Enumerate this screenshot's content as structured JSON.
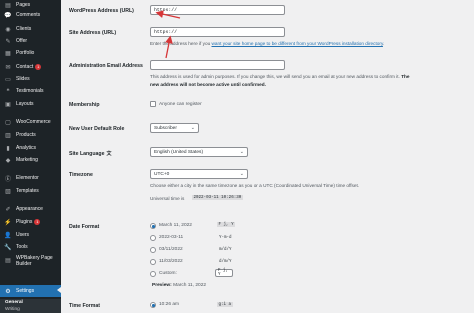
{
  "sidebar": {
    "items": [
      {
        "label": "Pages",
        "icon": "pages-icon",
        "glyph": "▤"
      },
      {
        "label": "Comments",
        "icon": "comments-icon",
        "glyph": "💬"
      },
      {
        "label": "Clients",
        "icon": "clients-icon",
        "glyph": "◉"
      },
      {
        "label": "Offer",
        "icon": "offer-icon",
        "glyph": "✎"
      },
      {
        "label": "Portfolio",
        "icon": "portfolio-icon",
        "glyph": "▦"
      },
      {
        "label": "Contact",
        "icon": "contact-icon",
        "glyph": "✉",
        "badge": "1"
      },
      {
        "label": "Slides",
        "icon": "slides-icon",
        "glyph": "▭"
      },
      {
        "label": "Testimonials",
        "icon": "testimonials-icon",
        "glyph": "❝"
      },
      {
        "label": "Layouts",
        "icon": "layouts-icon",
        "glyph": "▣"
      },
      {
        "label": "WooCommerce",
        "icon": "woocommerce-icon",
        "glyph": "▢"
      },
      {
        "label": "Products",
        "icon": "products-icon",
        "glyph": "▥"
      },
      {
        "label": "Analytics",
        "icon": "analytics-icon",
        "glyph": "▮"
      },
      {
        "label": "Marketing",
        "icon": "marketing-icon",
        "glyph": "◆"
      },
      {
        "label": "Elementor",
        "icon": "elementor-icon",
        "glyph": "Ⓔ"
      },
      {
        "label": "Templates",
        "icon": "templates-icon",
        "glyph": "▧"
      },
      {
        "label": "Appearance",
        "icon": "appearance-icon",
        "glyph": "✐"
      },
      {
        "label": "Plugins",
        "icon": "plugins-icon",
        "glyph": "⚡",
        "badge": "1"
      },
      {
        "label": "Users",
        "icon": "users-icon",
        "glyph": "👤"
      },
      {
        "label": "Tools",
        "icon": "tools-icon",
        "glyph": "🔧"
      },
      {
        "label": "WPBakery Page Builder",
        "icon": "wpbakery-icon",
        "glyph": "▤"
      },
      {
        "label": "Settings",
        "icon": "settings-icon",
        "glyph": "⚙"
      }
    ],
    "submenu": [
      "General",
      "Writing"
    ]
  },
  "form": {
    "wordpress_address": {
      "label": "WordPress Address (URL)",
      "value": "https://"
    },
    "site_address": {
      "label": "Site Address (URL)",
      "value": "https://",
      "desc_before": "Enter the address here if you ",
      "desc_link": "want your site home page to be different from your WordPress installation directory",
      "desc_after": "."
    },
    "admin_email": {
      "label": "Administration Email Address",
      "desc_line1": "This address is used for admin purposes. If you change this, we will send you an email at your new address to confirm it.",
      "desc_line2": "The",
      "desc_line3": "new address will not become active until confirmed."
    },
    "membership": {
      "label": "Membership",
      "checkbox_label": "Anyone can register"
    },
    "default_role": {
      "label": "New User Default Role",
      "value": "Subscriber"
    },
    "site_language": {
      "label": "Site Language",
      "value": "English (United States)"
    },
    "timezone": {
      "label": "Timezone",
      "value": "UTC+0",
      "desc": "Choose either a city in the same timezone as you or a UTC (Coordinated Universal Time) time offset.",
      "universal_label": "Universal time is",
      "universal_value": "2022-03-11 10:26:30"
    },
    "date_format": {
      "label": "Date Format",
      "options": [
        {
          "label": "March 11, 2022",
          "code": "F j, Y",
          "checked": true
        },
        {
          "label": "2022-03-11",
          "code": "Y-m-d",
          "checked": false
        },
        {
          "label": "03/11/2022",
          "code": "m/d/Y",
          "checked": false
        },
        {
          "label": "11/03/2022",
          "code": "d/m/Y",
          "checked": false
        },
        {
          "label": "Custom:",
          "code": "F j, Y",
          "checked": false
        }
      ],
      "preview_label": "Preview:",
      "preview_value": "March 11, 2022"
    },
    "time_format": {
      "label": "Time Format",
      "options": [
        {
          "label": "10:26 am",
          "code": "g:i a",
          "checked": true
        }
      ]
    }
  },
  "colors": {
    "accent": "#2271b1",
    "sidebar_bg": "#1d2327",
    "arrow": "#d63638"
  }
}
